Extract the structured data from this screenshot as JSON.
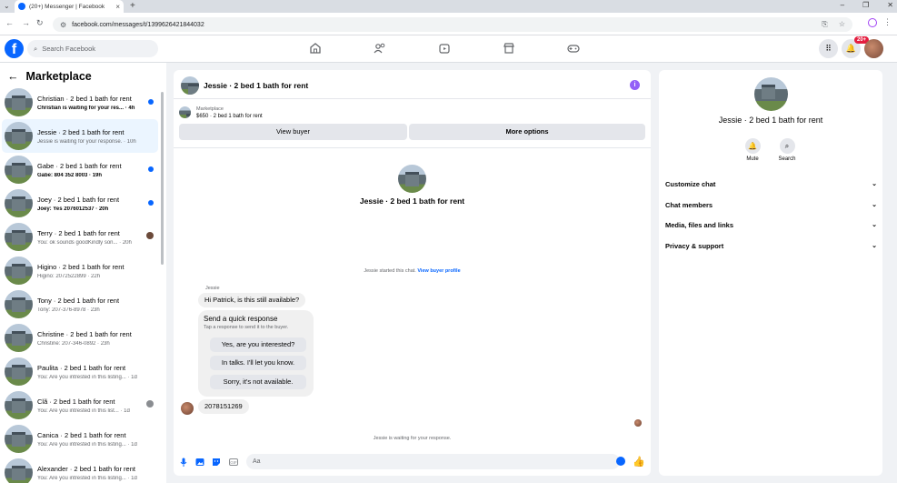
{
  "browser": {
    "tab_title": "(20+) Messenger | Facebook",
    "url": "facebook.com/messages/t/1399626421844032"
  },
  "topbar": {
    "search_placeholder": "Search Facebook",
    "notif_badge": "20+"
  },
  "left": {
    "title": "Marketplace",
    "conversations": [
      {
        "name": "Christian · 2 bed 1 bath for rent",
        "preview": "Christian is waiting for your res... · 4h",
        "unread": true
      },
      {
        "name": "Jessie · 2 bed 1 bath for rent",
        "preview": "Jessie is waiting for your response. · 10h",
        "active": true
      },
      {
        "name": "Gabe · 2 bed 1 bath for rent",
        "preview": "Gabe: 804 352 8003 · 19h",
        "unread": true
      },
      {
        "name": "Joey · 2 bed 1 bath for rent",
        "preview": "Joey: Yes 2076012537 · 20h",
        "unread": true
      },
      {
        "name": "Terry · 2 bed 1 bath for rent",
        "preview": "You: ok sounds goodKindly son... · 20h"
      },
      {
        "name": "Higino · 2 bed 1 bath for rent",
        "preview": "Higino: 2072522899 · 22h"
      },
      {
        "name": "Tony · 2 bed 1 bath for rent",
        "preview": "Tony: 207-376-8978 · 23h"
      },
      {
        "name": "Christine · 2 bed 1 bath for rent",
        "preview": "Christine: 207-346-0892 · 23h"
      },
      {
        "name": "Paulita · 2 bed 1 bath for rent",
        "preview": "You: Are you intrested in this listing... · 1d"
      },
      {
        "name": "Clã · 2 bed 1 bath for rent",
        "preview": "You: Are you intrested in this list... · 1d"
      },
      {
        "name": "Canica · 2 bed 1 bath for rent",
        "preview": "You: Are you intrested in this listing... · 1d"
      },
      {
        "name": "Alexander · 2 bed 1 bath for rent",
        "preview": "You: Are you intrested in this listing... · 1d"
      }
    ]
  },
  "chat": {
    "header_title": "Jessie · 2 bed 1 bath for rent",
    "marketplace_label": "Marketplace",
    "listing": "$650 · 2 bed 1 bath for rent",
    "view_buyer": "View buyer",
    "more_options": "More options",
    "center_title": "Jessie · 2 bed 1 bath for rent",
    "started_text": "Jessie started this chat.",
    "view_buyer_profile": "View buyer profile",
    "sender": "Jessie",
    "message1": "Hi Patrick, is this still available?",
    "quick_title": "Send a quick response",
    "quick_sub": "Tap a response to send it to the buyer.",
    "quick_options": [
      "Yes, are you interested?",
      "In talks. I'll let you know.",
      "Sorry, it's not available."
    ],
    "message2": "2078151269",
    "waiting": "Jessie is waiting for your response.",
    "composer_placeholder": "Aa"
  },
  "details": {
    "title": "Jessie · 2 bed 1 bath for rent",
    "mute": "Mute",
    "search": "Search",
    "sections": [
      "Customize chat",
      "Chat members",
      "Media, files and links",
      "Privacy & support"
    ]
  }
}
